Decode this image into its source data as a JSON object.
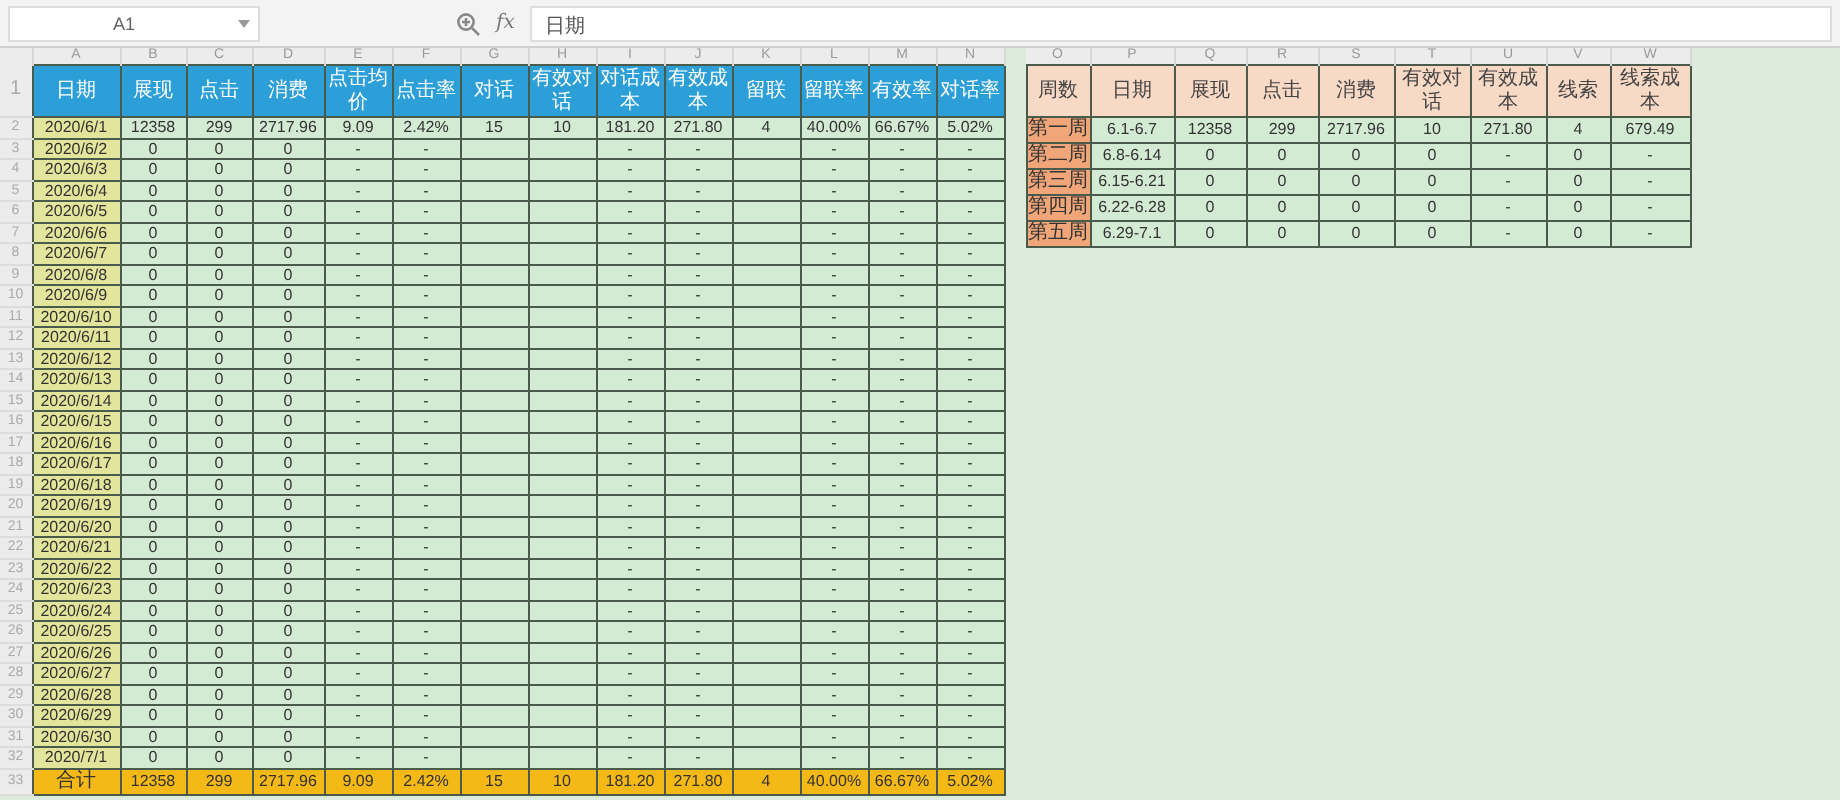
{
  "formula_bar": {
    "name_box": "A1",
    "fx_label": "fx",
    "formula": "日期"
  },
  "main_table": {
    "column_letters": [
      "A",
      "B",
      "C",
      "D",
      "E",
      "F",
      "G",
      "H",
      "I",
      "J",
      "K",
      "L",
      "M",
      "N"
    ],
    "rows": [
      {
        "kind": "header",
        "number": "1",
        "cells": [
          "日期",
          "展现",
          "点击",
          "消费",
          "点击均价",
          "点击率",
          "对话",
          "有效对话",
          "对话成本",
          "有效成本",
          "留联",
          "留联率",
          "有效率",
          "对话率"
        ]
      },
      {
        "kind": "data",
        "number": "2",
        "cells": [
          "2020/6/1",
          "12358",
          "299",
          "2717.96",
          "9.09",
          "2.42%",
          "15",
          "10",
          "181.20",
          "271.80",
          "4",
          "40.00%",
          "66.67%",
          "5.02%"
        ]
      },
      {
        "kind": "data",
        "number": "3",
        "cells": [
          "2020/6/2",
          "0",
          "0",
          "0",
          "-",
          "-",
          null,
          null,
          "-",
          "-",
          null,
          "-",
          "-",
          "-"
        ]
      },
      {
        "kind": "data",
        "number": "4",
        "cells": [
          "2020/6/3",
          "0",
          "0",
          "0",
          "-",
          "-",
          null,
          null,
          "-",
          "-",
          null,
          "-",
          "-",
          "-"
        ]
      },
      {
        "kind": "data",
        "number": "5",
        "cells": [
          "2020/6/4",
          "0",
          "0",
          "0",
          "-",
          "-",
          null,
          null,
          "-",
          "-",
          null,
          "-",
          "-",
          "-"
        ]
      },
      {
        "kind": "data",
        "number": "6",
        "cells": [
          "2020/6/5",
          "0",
          "0",
          "0",
          "-",
          "-",
          null,
          null,
          "-",
          "-",
          null,
          "-",
          "-",
          "-"
        ]
      },
      {
        "kind": "data",
        "number": "7",
        "cells": [
          "2020/6/6",
          "0",
          "0",
          "0",
          "-",
          "-",
          null,
          null,
          "-",
          "-",
          null,
          "-",
          "-",
          "-"
        ]
      },
      {
        "kind": "data",
        "number": "8",
        "cells": [
          "2020/6/7",
          "0",
          "0",
          "0",
          "-",
          "-",
          null,
          null,
          "-",
          "-",
          null,
          "-",
          "-",
          "-"
        ]
      },
      {
        "kind": "data",
        "number": "9",
        "cells": [
          "2020/6/8",
          "0",
          "0",
          "0",
          "-",
          "-",
          null,
          null,
          "-",
          "-",
          null,
          "-",
          "-",
          "-"
        ]
      },
      {
        "kind": "data",
        "number": "10",
        "cells": [
          "2020/6/9",
          "0",
          "0",
          "0",
          "-",
          "-",
          null,
          null,
          "-",
          "-",
          null,
          "-",
          "-",
          "-"
        ]
      },
      {
        "kind": "data",
        "number": "11",
        "cells": [
          "2020/6/10",
          "0",
          "0",
          "0",
          "-",
          "-",
          null,
          null,
          "-",
          "-",
          null,
          "-",
          "-",
          "-"
        ]
      },
      {
        "kind": "data",
        "number": "12",
        "cells": [
          "2020/6/11",
          "0",
          "0",
          "0",
          "-",
          "-",
          null,
          null,
          "-",
          "-",
          null,
          "-",
          "-",
          "-"
        ]
      },
      {
        "kind": "data",
        "number": "13",
        "cells": [
          "2020/6/12",
          "0",
          "0",
          "0",
          "-",
          "-",
          null,
          null,
          "-",
          "-",
          null,
          "-",
          "-",
          "-"
        ]
      },
      {
        "kind": "data",
        "number": "14",
        "cells": [
          "2020/6/13",
          "0",
          "0",
          "0",
          "-",
          "-",
          null,
          null,
          "-",
          "-",
          null,
          "-",
          "-",
          "-"
        ]
      },
      {
        "kind": "data",
        "number": "15",
        "cells": [
          "2020/6/14",
          "0",
          "0",
          "0",
          "-",
          "-",
          null,
          null,
          "-",
          "-",
          null,
          "-",
          "-",
          "-"
        ]
      },
      {
        "kind": "data",
        "number": "16",
        "cells": [
          "2020/6/15",
          "0",
          "0",
          "0",
          "-",
          "-",
          null,
          null,
          "-",
          "-",
          null,
          "-",
          "-",
          "-"
        ]
      },
      {
        "kind": "data",
        "number": "17",
        "cells": [
          "2020/6/16",
          "0",
          "0",
          "0",
          "-",
          "-",
          null,
          null,
          "-",
          "-",
          null,
          "-",
          "-",
          "-"
        ]
      },
      {
        "kind": "data",
        "number": "18",
        "cells": [
          "2020/6/17",
          "0",
          "0",
          "0",
          "-",
          "-",
          null,
          null,
          "-",
          "-",
          null,
          "-",
          "-",
          "-"
        ]
      },
      {
        "kind": "data",
        "number": "19",
        "cells": [
          "2020/6/18",
          "0",
          "0",
          "0",
          "-",
          "-",
          null,
          null,
          "-",
          "-",
          null,
          "-",
          "-",
          "-"
        ]
      },
      {
        "kind": "data",
        "number": "20",
        "cells": [
          "2020/6/19",
          "0",
          "0",
          "0",
          "-",
          "-",
          null,
          null,
          "-",
          "-",
          null,
          "-",
          "-",
          "-"
        ]
      },
      {
        "kind": "data",
        "number": "21",
        "cells": [
          "2020/6/20",
          "0",
          "0",
          "0",
          "-",
          "-",
          null,
          null,
          "-",
          "-",
          null,
          "-",
          "-",
          "-"
        ]
      },
      {
        "kind": "data",
        "number": "22",
        "cells": [
          "2020/6/21",
          "0",
          "0",
          "0",
          "-",
          "-",
          null,
          null,
          "-",
          "-",
          null,
          "-",
          "-",
          "-"
        ]
      },
      {
        "kind": "data",
        "number": "23",
        "cells": [
          "2020/6/22",
          "0",
          "0",
          "0",
          "-",
          "-",
          null,
          null,
          "-",
          "-",
          null,
          "-",
          "-",
          "-"
        ]
      },
      {
        "kind": "data",
        "number": "24",
        "cells": [
          "2020/6/23",
          "0",
          "0",
          "0",
          "-",
          "-",
          null,
          null,
          "-",
          "-",
          null,
          "-",
          "-",
          "-"
        ]
      },
      {
        "kind": "data",
        "number": "25",
        "cells": [
          "2020/6/24",
          "0",
          "0",
          "0",
          "-",
          "-",
          null,
          null,
          "-",
          "-",
          null,
          "-",
          "-",
          "-"
        ]
      },
      {
        "kind": "data",
        "number": "26",
        "cells": [
          "2020/6/25",
          "0",
          "0",
          "0",
          "-",
          "-",
          null,
          null,
          "-",
          "-",
          null,
          "-",
          "-",
          "-"
        ]
      },
      {
        "kind": "data",
        "number": "27",
        "cells": [
          "2020/6/26",
          "0",
          "0",
          "0",
          "-",
          "-",
          null,
          null,
          "-",
          "-",
          null,
          "-",
          "-",
          "-"
        ]
      },
      {
        "kind": "data",
        "number": "28",
        "cells": [
          "2020/6/27",
          "0",
          "0",
          "0",
          "-",
          "-",
          null,
          null,
          "-",
          "-",
          null,
          "-",
          "-",
          "-"
        ]
      },
      {
        "kind": "data",
        "number": "29",
        "cells": [
          "2020/6/28",
          "0",
          "0",
          "0",
          "-",
          "-",
          null,
          null,
          "-",
          "-",
          null,
          "-",
          "-",
          "-"
        ]
      },
      {
        "kind": "data",
        "number": "30",
        "cells": [
          "2020/6/29",
          "0",
          "0",
          "0",
          "-",
          "-",
          null,
          null,
          "-",
          "-",
          null,
          "-",
          "-",
          "-"
        ]
      },
      {
        "kind": "data",
        "number": "31",
        "cells": [
          "2020/6/30",
          "0",
          "0",
          "0",
          "-",
          "-",
          null,
          null,
          "-",
          "-",
          null,
          "-",
          "-",
          "-"
        ]
      },
      {
        "kind": "data",
        "number": "32",
        "cells": [
          "2020/7/1",
          "0",
          "0",
          "0",
          "-",
          "-",
          null,
          null,
          "-",
          "-",
          null,
          "-",
          "-",
          "-"
        ]
      },
      {
        "kind": "total",
        "number": "33",
        "cells": [
          "合计",
          "12358",
          "299",
          "2717.96",
          "9.09",
          "2.42%",
          "15",
          "10",
          "181.20",
          "271.80",
          "4",
          "40.00%",
          "66.67%",
          "5.02%"
        ]
      }
    ]
  },
  "weekly_table": {
    "column_letters": [
      "O",
      "P",
      "Q",
      "R",
      "S",
      "T",
      "U",
      "V",
      "W"
    ],
    "rows": [
      {
        "kind": "header",
        "cells": [
          "周数",
          "日期",
          "展现",
          "点击",
          "消费",
          "有效对话",
          "有效成本",
          "线索",
          "线索成本"
        ]
      },
      {
        "kind": "data",
        "cells": [
          "第一周",
          "6.1-6.7",
          "12358",
          "299",
          "2717.96",
          "10",
          "271.80",
          "4",
          "679.49"
        ]
      },
      {
        "kind": "data",
        "cells": [
          "第二周",
          "6.8-6.14",
          "0",
          "0",
          "0",
          "0",
          "-",
          "0",
          "-"
        ]
      },
      {
        "kind": "data",
        "cells": [
          "第三周",
          "6.15-6.21",
          "0",
          "0",
          "0",
          "0",
          "-",
          "0",
          "-"
        ]
      },
      {
        "kind": "data",
        "cells": [
          "第四周",
          "6.22-6.28",
          "0",
          "0",
          "0",
          "0",
          "-",
          "0",
          "-"
        ]
      },
      {
        "kind": "data",
        "cells": [
          "第五周",
          "6.29-7.1",
          "0",
          "0",
          "0",
          "0",
          "-",
          "0",
          "-"
        ]
      }
    ]
  }
}
